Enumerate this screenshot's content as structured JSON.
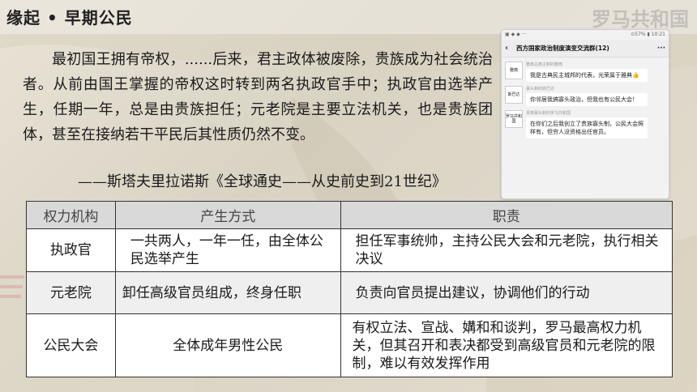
{
  "title": "缘起 • 早期公民",
  "watermark": "罗马共和国",
  "quote": {
    "text": "最初国王拥有帝权，......后来，君主政体被废除，贵族成为社会统治者。从前由国王掌握的帝权这时转到两名执政官手中；执政官由选举产生，任期一年，总是由贵族担任；元老院是主要立法机关，也是贵族团体，甚至在接纳若干平民后其性质仍然不变。",
    "source": "——斯塔夫里拉诺斯《全球通史——从史前史到21世纪》"
  },
  "phone": {
    "status_left": "▣ ◆ ◆ ···",
    "status_right": "⊙57% ▮ 10:21",
    "chat_title": "西方国家政治制度演变交流群(12)",
    "messages": [
      {
        "avatar": "雅典",
        "sender": "雅典古典主制的雅典",
        "text": "我是古典民主城邦的代表，光荣属于雅典👍"
      },
      {
        "avatar": "斯巴达",
        "sender": "寡头制的斯巴达",
        "text": "你邻居我搞寡头政治，但我也有公民大会！"
      },
      {
        "avatar": "罗马共和国",
        "sender": "贵族寡头制的罗马共和国",
        "text": "在你们之后我创立了贵族寡头制，公民大会照样有，但穷人没资格出任官员。"
      }
    ]
  },
  "table": {
    "headers": [
      "权力机构",
      "产生方式",
      "职责"
    ],
    "rows": [
      {
        "org": "执政官",
        "method": "一共两人，一年一任，由全体公民选举产生",
        "duty": "担任军事统帅，主持公民大会和元老院，执行相关决议"
      },
      {
        "org": "元老院",
        "method": "卸任高级官员组成，终身任职",
        "duty": "负责向官员提出建议，协调他们的行动"
      },
      {
        "org": "公民大会",
        "method": "全体成年男性公民",
        "duty": "有权立法、宣战、媾和和谈判，罗马最高权力机关，但其召开和表决都受到高级官员和元老院的限制，难以有效发挥作用"
      }
    ]
  }
}
